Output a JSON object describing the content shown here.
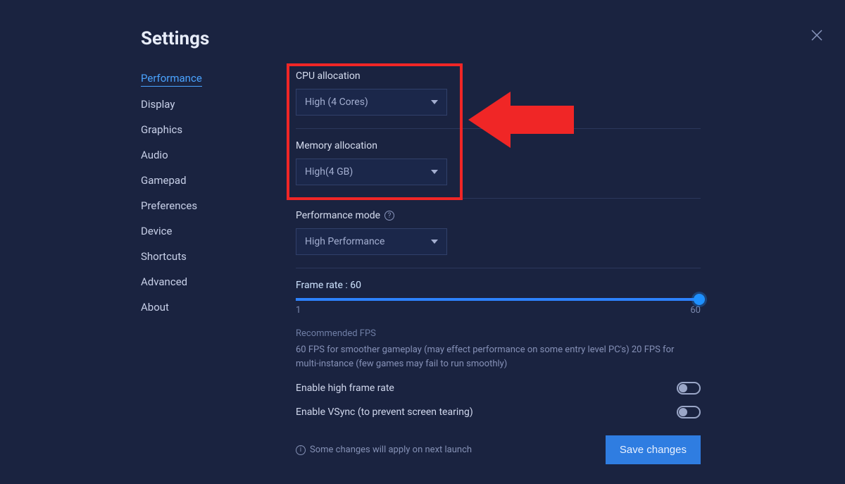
{
  "title": "Settings",
  "sidebar": {
    "items": [
      {
        "label": "Performance",
        "active": true
      },
      {
        "label": "Display"
      },
      {
        "label": "Graphics"
      },
      {
        "label": "Audio"
      },
      {
        "label": "Gamepad"
      },
      {
        "label": "Preferences"
      },
      {
        "label": "Device"
      },
      {
        "label": "Shortcuts"
      },
      {
        "label": "Advanced"
      },
      {
        "label": "About"
      }
    ]
  },
  "cpu": {
    "label": "CPU allocation",
    "value": "High (4 Cores)"
  },
  "memory": {
    "label": "Memory allocation",
    "value": "High(4 GB)"
  },
  "perf_mode": {
    "label": "Performance mode",
    "value": "High Performance"
  },
  "frame_rate": {
    "label": "Frame rate : 60",
    "min": "1",
    "max": "60",
    "value": 60
  },
  "recommended": {
    "title": "Recommended FPS",
    "text": "60 FPS for smoother gameplay (may effect performance on some entry level PC's) 20 FPS for multi-instance (few games may fail to run smoothly)"
  },
  "toggles": {
    "high_frame": {
      "label": "Enable high frame rate",
      "on": false
    },
    "vsync": {
      "label": "Enable VSync (to prevent screen tearing)",
      "on": false
    }
  },
  "footer": {
    "note": "Some changes will apply on next launch",
    "save": "Save changes"
  }
}
